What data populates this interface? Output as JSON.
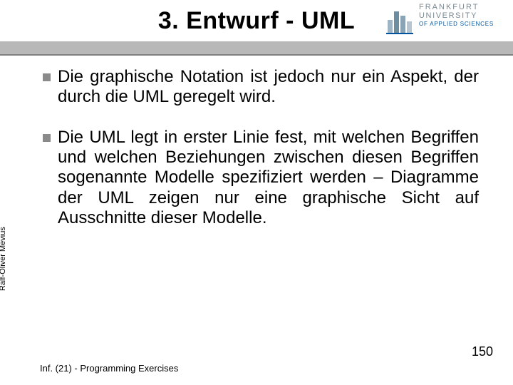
{
  "title": "3. Entwurf - UML",
  "logo": {
    "line1": "FRANKFURT",
    "line2": "UNIVERSITY",
    "line3": "OF APPLIED SCIENCES"
  },
  "bullets": [
    "Die graphische Notation ist jedoch nur ein Aspekt, der durch die UML geregelt wird.",
    "Die UML legt in erster Linie fest, mit welchen Begriffen und welchen Beziehungen zwischen diesen Begriffen sogenannte Modelle spezifiziert werden – Diagramme der UML zeigen nur eine graphische Sicht auf Ausschnitte dieser Modelle."
  ],
  "author": "Ralf-Oliver Mevius",
  "footer": "Inf. (21) - Programming Exercises",
  "page": "150"
}
